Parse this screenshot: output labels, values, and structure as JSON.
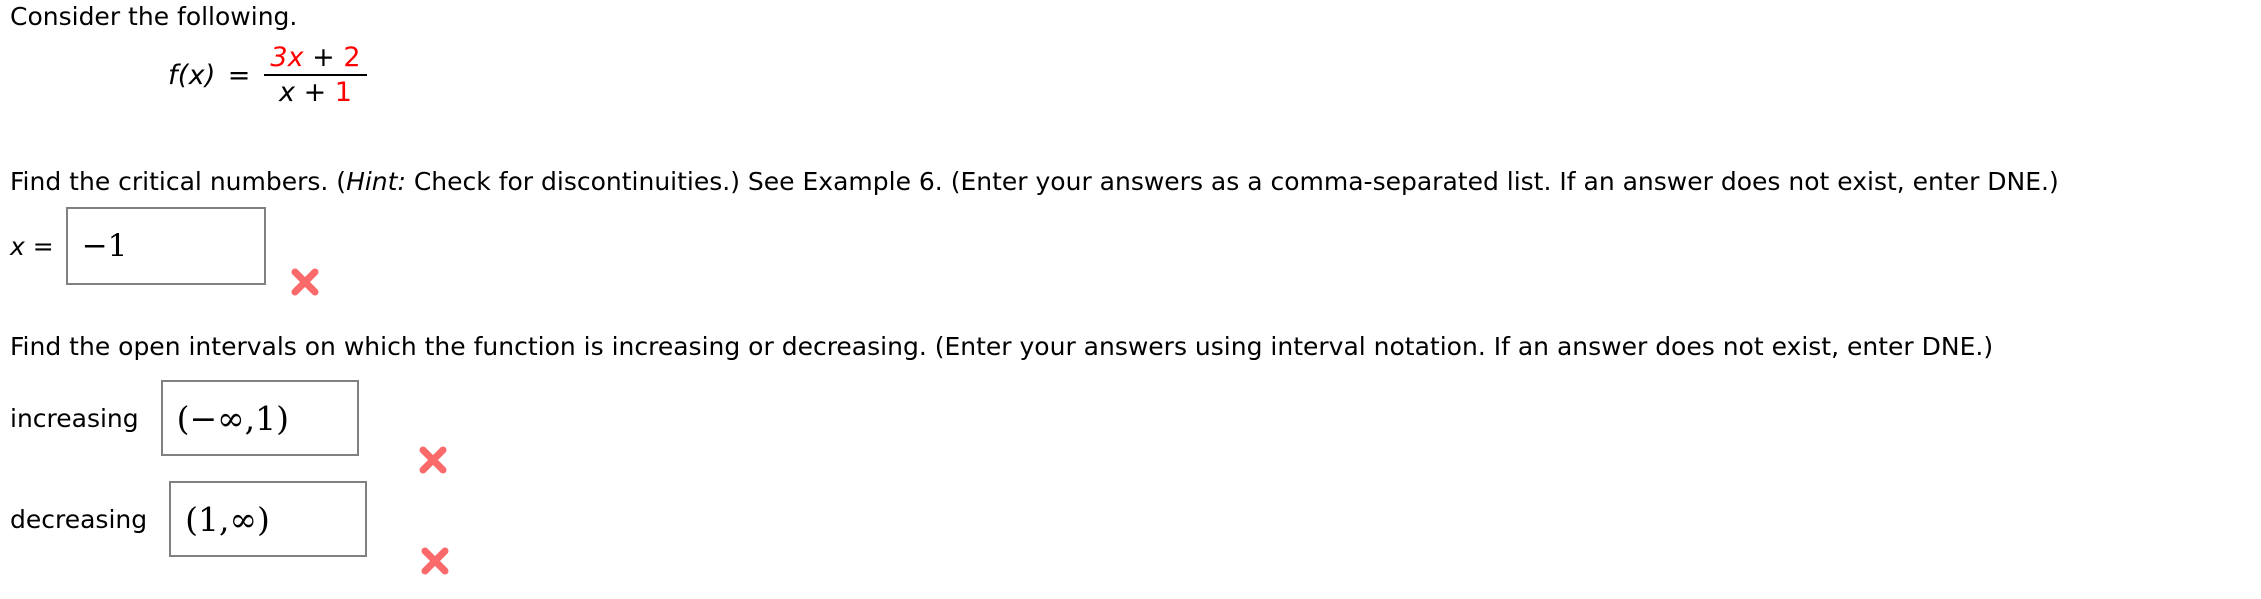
{
  "intro": {
    "text": "Consider the following."
  },
  "formula": {
    "function_label": "f(x)",
    "equals": "=",
    "numerator": {
      "coefficient_term": "3x",
      "operator": "+",
      "constant": "2"
    },
    "denominator": {
      "variable": "x",
      "operator": "+",
      "constant": "1"
    },
    "colors": {
      "highlight": "#ff0000",
      "plain": "#000000"
    }
  },
  "question_critical_numbers": {
    "prompt_before_hint": "Find the critical numbers. (",
    "hint_word": "Hint:",
    "prompt_after_hint": " Check for discontinuities.) See Example 6. (Enter your answers as a comma-separated list. If an answer does not exist, enter DNE.)",
    "answer_label": "x =",
    "answer_value": "−1",
    "status": "incorrect"
  },
  "question_intervals": {
    "prompt": "Find the open intervals on which the function is increasing or decreasing. (Enter your answers using interval notation. If an answer does not exist, enter DNE.)",
    "rows": [
      {
        "label": "increasing",
        "value": "(−∞,1)",
        "status": "incorrect"
      },
      {
        "label": "decreasing",
        "value": "(1,∞)",
        "status": "incorrect"
      }
    ]
  },
  "status_marks": {
    "incorrect_glyph": "✖",
    "incorrect_color": "#fa6a6a"
  }
}
